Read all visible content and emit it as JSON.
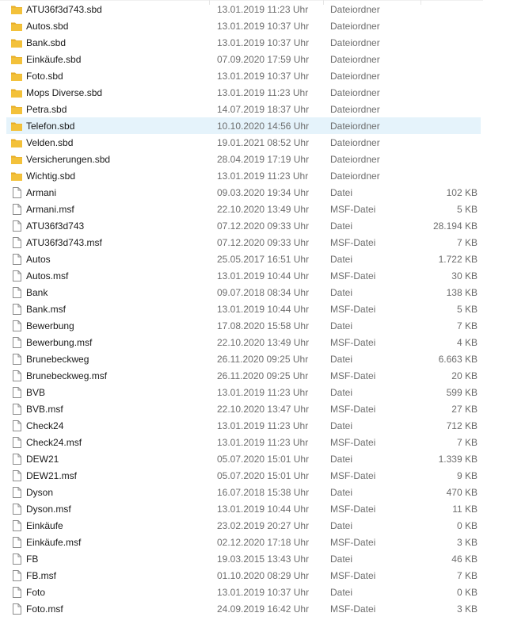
{
  "window_title": "",
  "colors": {
    "folder": "#f3c13a",
    "folder_shade": "#e6ac27",
    "selected_row": "#e5f3fb",
    "file_icon_stroke": "#8c8c8c"
  },
  "files": [
    {
      "name": "ATU36f3d743.sbd",
      "date": "13.01.2019 11:23 Uhr",
      "type": "Dateiordner",
      "size": "",
      "icon": "folder-icon"
    },
    {
      "name": "Autos.sbd",
      "date": "13.01.2019 10:37 Uhr",
      "type": "Dateiordner",
      "size": "",
      "icon": "folder-icon"
    },
    {
      "name": "Bank.sbd",
      "date": "13.01.2019 10:37 Uhr",
      "type": "Dateiordner",
      "size": "",
      "icon": "folder-icon"
    },
    {
      "name": "Einkäufe.sbd",
      "date": "07.09.2020 17:59 Uhr",
      "type": "Dateiordner",
      "size": "",
      "icon": "folder-icon"
    },
    {
      "name": "Foto.sbd",
      "date": "13.01.2019 10:37 Uhr",
      "type": "Dateiordner",
      "size": "",
      "icon": "folder-icon"
    },
    {
      "name": "Mops Diverse.sbd",
      "date": "13.01.2019 11:23 Uhr",
      "type": "Dateiordner",
      "size": "",
      "icon": "folder-icon"
    },
    {
      "name": "Petra.sbd",
      "date": "14.07.2019 18:37 Uhr",
      "type": "Dateiordner",
      "size": "",
      "icon": "folder-icon"
    },
    {
      "name": "Telefon.sbd",
      "date": "10.10.2020 14:56 Uhr",
      "type": "Dateiordner",
      "size": "",
      "icon": "folder-icon",
      "selected": true
    },
    {
      "name": "Velden.sbd",
      "date": "19.01.2021 08:52 Uhr",
      "type": "Dateiordner",
      "size": "",
      "icon": "folder-icon"
    },
    {
      "name": "Versicherungen.sbd",
      "date": "28.04.2019 17:19 Uhr",
      "type": "Dateiordner",
      "size": "",
      "icon": "folder-icon"
    },
    {
      "name": "Wichtig.sbd",
      "date": "13.01.2019 11:23 Uhr",
      "type": "Dateiordner",
      "size": "",
      "icon": "folder-icon"
    },
    {
      "name": "Armani",
      "date": "09.03.2020 19:34 Uhr",
      "type": "Datei",
      "size": "102 KB",
      "icon": "file-icon"
    },
    {
      "name": "Armani.msf",
      "date": "22.10.2020 13:49 Uhr",
      "type": "MSF-Datei",
      "size": "5 KB",
      "icon": "file-icon"
    },
    {
      "name": "ATU36f3d743",
      "date": "07.12.2020 09:33 Uhr",
      "type": "Datei",
      "size": "28.194 KB",
      "icon": "file-icon"
    },
    {
      "name": "ATU36f3d743.msf",
      "date": "07.12.2020 09:33 Uhr",
      "type": "MSF-Datei",
      "size": "7 KB",
      "icon": "file-icon"
    },
    {
      "name": "Autos",
      "date": "25.05.2017 16:51 Uhr",
      "type": "Datei",
      "size": "1.722 KB",
      "icon": "file-icon"
    },
    {
      "name": "Autos.msf",
      "date": "13.01.2019 10:44 Uhr",
      "type": "MSF-Datei",
      "size": "30 KB",
      "icon": "file-icon"
    },
    {
      "name": "Bank",
      "date": "09.07.2018 08:34 Uhr",
      "type": "Datei",
      "size": "138 KB",
      "icon": "file-icon"
    },
    {
      "name": "Bank.msf",
      "date": "13.01.2019 10:44 Uhr",
      "type": "MSF-Datei",
      "size": "5 KB",
      "icon": "file-icon"
    },
    {
      "name": "Bewerbung",
      "date": "17.08.2020 15:58 Uhr",
      "type": "Datei",
      "size": "7 KB",
      "icon": "file-icon"
    },
    {
      "name": "Bewerbung.msf",
      "date": "22.10.2020 13:49 Uhr",
      "type": "MSF-Datei",
      "size": "4 KB",
      "icon": "file-icon"
    },
    {
      "name": "Brunebeckweg",
      "date": "26.11.2020 09:25 Uhr",
      "type": "Datei",
      "size": "6.663 KB",
      "icon": "file-icon"
    },
    {
      "name": "Brunebeckweg.msf",
      "date": "26.11.2020 09:25 Uhr",
      "type": "MSF-Datei",
      "size": "20 KB",
      "icon": "file-icon"
    },
    {
      "name": "BVB",
      "date": "13.01.2019 11:23 Uhr",
      "type": "Datei",
      "size": "599 KB",
      "icon": "file-icon"
    },
    {
      "name": "BVB.msf",
      "date": "22.10.2020 13:47 Uhr",
      "type": "MSF-Datei",
      "size": "27 KB",
      "icon": "file-icon"
    },
    {
      "name": "Check24",
      "date": "13.01.2019 11:23 Uhr",
      "type": "Datei",
      "size": "712 KB",
      "icon": "file-icon"
    },
    {
      "name": "Check24.msf",
      "date": "13.01.2019 11:23 Uhr",
      "type": "MSF-Datei",
      "size": "7 KB",
      "icon": "file-icon"
    },
    {
      "name": "DEW21",
      "date": "05.07.2020 15:01 Uhr",
      "type": "Datei",
      "size": "1.339 KB",
      "icon": "file-icon"
    },
    {
      "name": "DEW21.msf",
      "date": "05.07.2020 15:01 Uhr",
      "type": "MSF-Datei",
      "size": "9 KB",
      "icon": "file-icon"
    },
    {
      "name": "Dyson",
      "date": "16.07.2018 15:38 Uhr",
      "type": "Datei",
      "size": "470 KB",
      "icon": "file-icon"
    },
    {
      "name": "Dyson.msf",
      "date": "13.01.2019 10:44 Uhr",
      "type": "MSF-Datei",
      "size": "11 KB",
      "icon": "file-icon"
    },
    {
      "name": "Einkäufe",
      "date": "23.02.2019 20:27 Uhr",
      "type": "Datei",
      "size": "0 KB",
      "icon": "file-icon"
    },
    {
      "name": "Einkäufe.msf",
      "date": "02.12.2020 17:18 Uhr",
      "type": "MSF-Datei",
      "size": "3 KB",
      "icon": "file-icon"
    },
    {
      "name": "FB",
      "date": "19.03.2015 13:43 Uhr",
      "type": "Datei",
      "size": "46 KB",
      "icon": "file-icon"
    },
    {
      "name": "FB.msf",
      "date": "01.10.2020 08:29 Uhr",
      "type": "MSF-Datei",
      "size": "7 KB",
      "icon": "file-icon"
    },
    {
      "name": "Foto",
      "date": "13.01.2019 10:37 Uhr",
      "type": "Datei",
      "size": "0 KB",
      "icon": "file-icon"
    },
    {
      "name": "Foto.msf",
      "date": "24.09.2019 16:42 Uhr",
      "type": "MSF-Datei",
      "size": "3 KB",
      "icon": "file-icon"
    }
  ]
}
